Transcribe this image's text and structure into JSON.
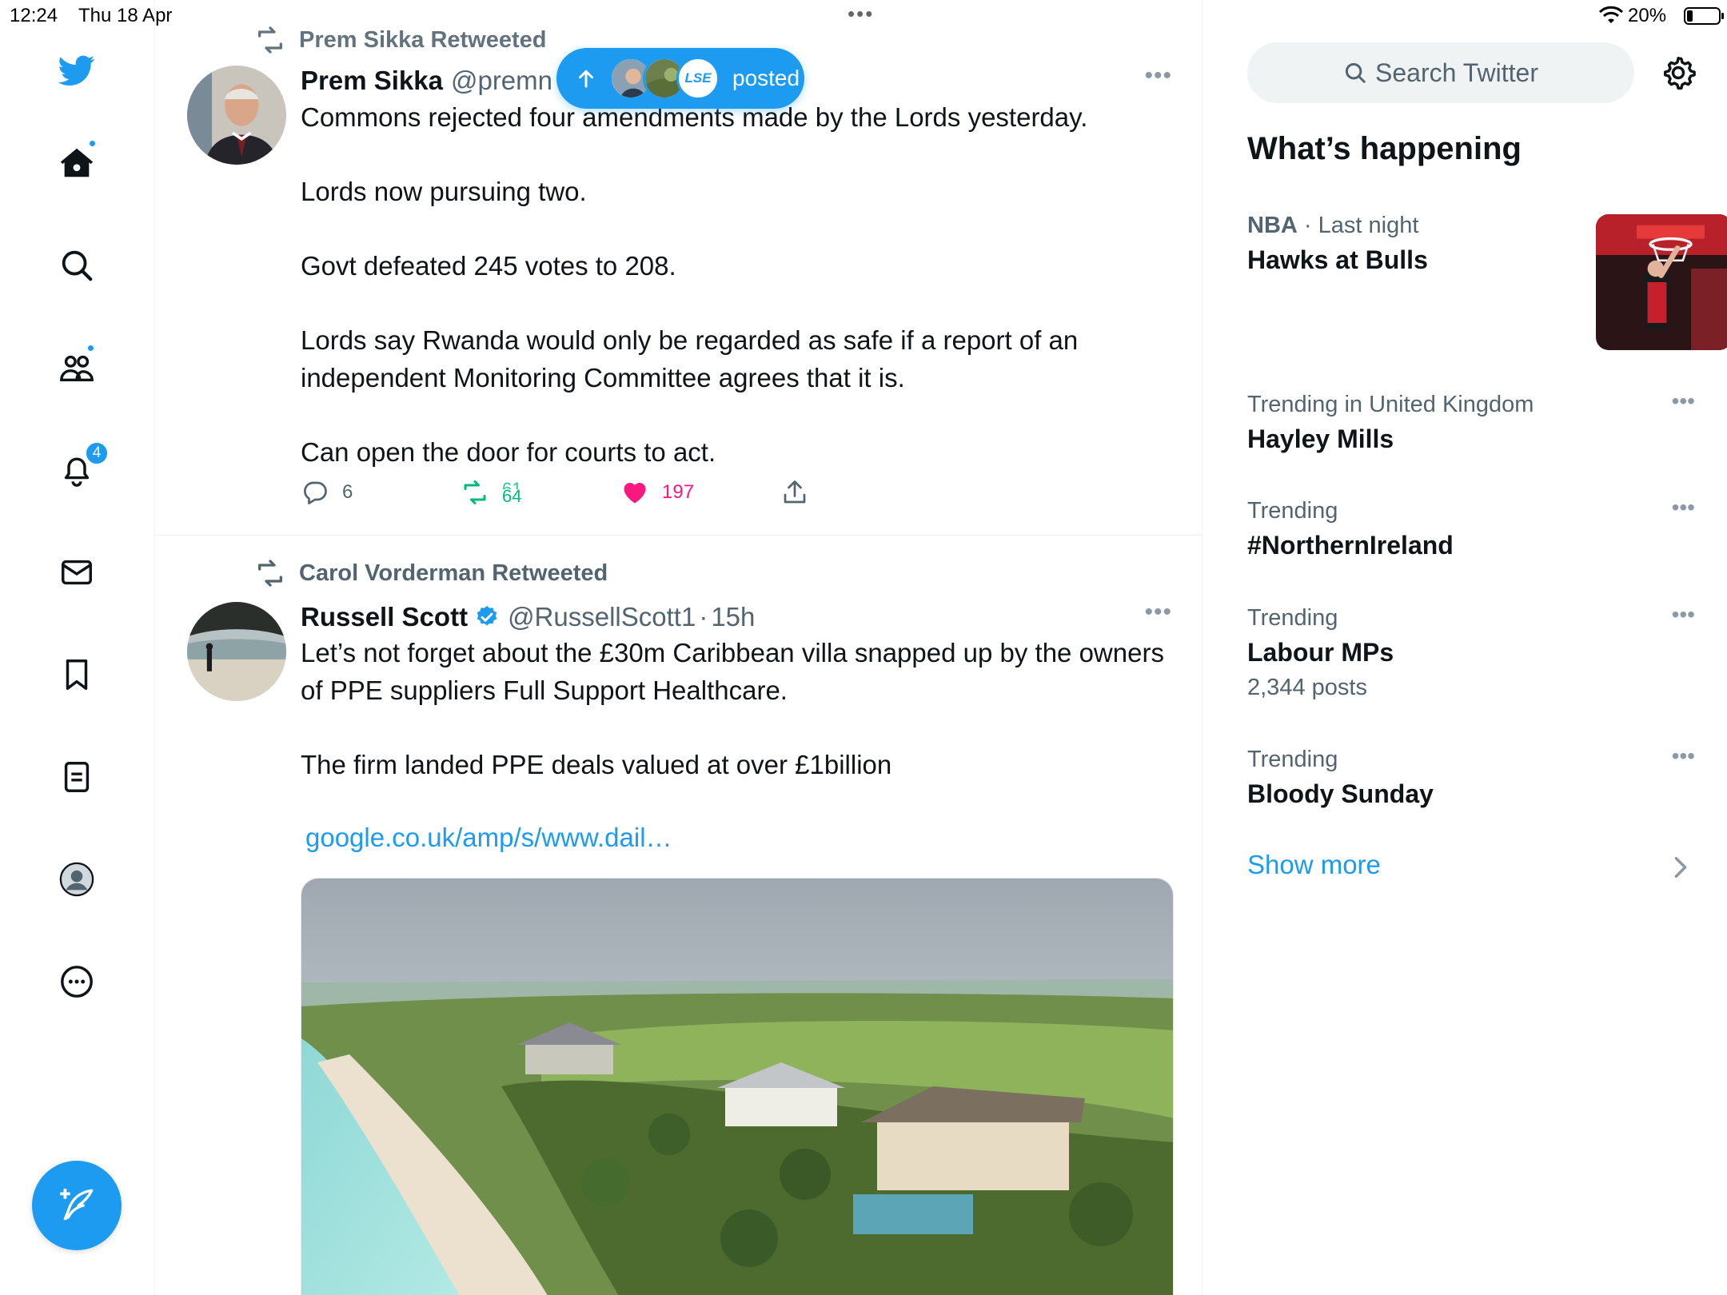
{
  "status_bar": {
    "time": "12:24",
    "date": "Thu 18 Apr",
    "battery": "20%"
  },
  "nav": {
    "icons": [
      "twitter-bird-icon",
      "home-icon",
      "search-icon",
      "communities-icon",
      "notifications-icon",
      "messages-icon",
      "bookmarks-icon",
      "lists-icon",
      "profile-icon",
      "more-icon"
    ],
    "notifications_badge": "4",
    "compose_icon": "compose-feather-icon"
  },
  "new_posts_pill": {
    "label": "posted",
    "mini_avatar_3_text": "LSE"
  },
  "timeline": {
    "tweet1": {
      "retweeted_by": "Prem Sikka Retweeted",
      "name": "Prem Sikka",
      "handle": "@premn",
      "paragraphs": [
        "Commons rejected four amendments made by the Lords yesterday.",
        "Lords now pursuing two.",
        "Govt defeated  245 votes to 208.",
        "Lords say Rwanda would only be regarded as safe if a report of an independent Monitoring Committee agrees that it is.",
        "Can open the door for courts to act."
      ],
      "replies": "6",
      "retweets_partial_top": "61",
      "retweets": "64",
      "likes": "197"
    },
    "tweet2": {
      "retweeted_by": "Carol Vorderman Retweeted",
      "name": "Russell Scott",
      "handle": "@RussellScott1",
      "time": "15h",
      "separator": "·",
      "paragraphs": [
        "Let’s not forget about the £30m Caribbean villa snapped up by the owners of PPE suppliers Full Support Healthcare.",
        "The firm landed PPE deals valued at over £1billion"
      ],
      "link": "google.co.uk/amp/s/www.dail…"
    }
  },
  "sidebar": {
    "search_placeholder": "Search Twitter",
    "title": "What’s happening",
    "trends": [
      {
        "category": "NBA",
        "meta_suffix": "· Last night",
        "topic": "Hawks at Bulls"
      },
      {
        "category": "Trending in United Kingdom",
        "topic": "Hayley Mills"
      },
      {
        "category": "Trending",
        "topic": "#NorthernIreland"
      },
      {
        "category": "Trending",
        "topic": "Labour MPs",
        "count": "2,344 posts"
      },
      {
        "category": "Trending",
        "topic": "Bloody Sunday"
      }
    ],
    "show_more": "Show more"
  },
  "colors": {
    "brand_blue": "#1d9bf0",
    "like_pink": "#f91880",
    "retweet_green": "#00ba7c",
    "secondary_text": "#536471"
  }
}
